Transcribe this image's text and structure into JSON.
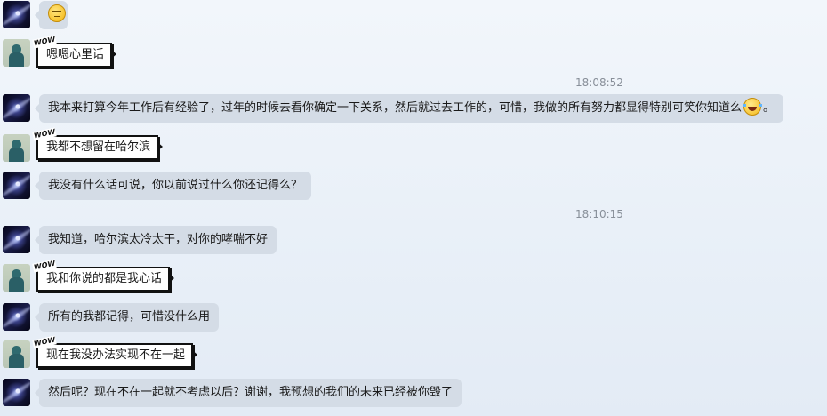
{
  "chat": {
    "messages": [
      {
        "kind": "gray",
        "sender": "galaxy",
        "text": "",
        "emoji": "sad-face"
      },
      {
        "kind": "comic",
        "sender": "person",
        "text": "嗯嗯心里话",
        "badge": "WOW"
      },
      {
        "kind": "time",
        "text": "18:08:52"
      },
      {
        "kind": "gray",
        "sender": "galaxy",
        "text": "我本来打算今年工作后有经验了，过年的时候去看你确定一下关系，然后就过去工作的，可惜，我做的所有努力都显得特别可笑你知道么",
        "emoji": "laughing-tears",
        "suffix": "。"
      },
      {
        "kind": "comic",
        "sender": "person",
        "text": "我都不想留在哈尔滨",
        "badge": "WOW"
      },
      {
        "kind": "gray",
        "sender": "galaxy",
        "text": "我没有什么话可说，你以前说过什么你还记得么？"
      },
      {
        "kind": "time",
        "text": "18:10:15"
      },
      {
        "kind": "gray",
        "sender": "galaxy",
        "text": "我知道，哈尔滨太冷太干，对你的哮喘不好"
      },
      {
        "kind": "comic",
        "sender": "person",
        "text": "我和你说的都是我心话",
        "badge": "WOW"
      },
      {
        "kind": "gray",
        "sender": "galaxy",
        "text": "所有的我都记得，可惜没什么用"
      },
      {
        "kind": "comic",
        "sender": "person",
        "text": "现在我没办法实现不在一起",
        "badge": "WOW"
      },
      {
        "kind": "gray",
        "sender": "galaxy",
        "text": "然后呢？现在不在一起就不考虑以后？谢谢，我预想的我们的未来已经被你毁了"
      }
    ]
  }
}
